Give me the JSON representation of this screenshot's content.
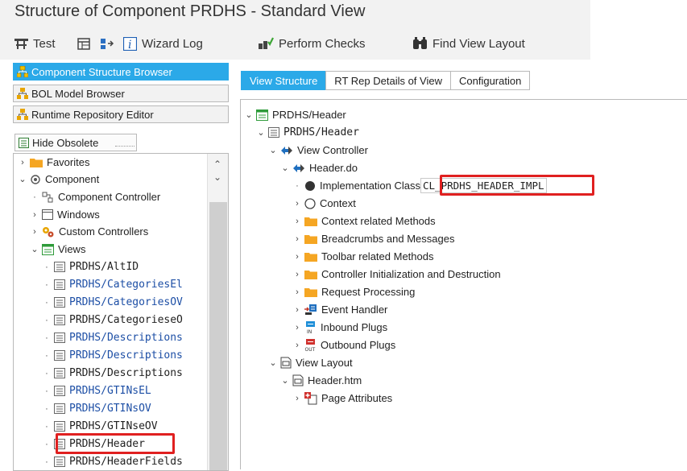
{
  "window": {
    "title": "Structure of Component PRDHS - Standard View"
  },
  "toolbar": {
    "test": "Test",
    "wizard_log": "Wizard Log",
    "perform_checks": "Perform Checks",
    "find_view_layout": "Find View Layout"
  },
  "nav": {
    "component_structure_browser": "Component Structure Browser",
    "bol_model_browser": "BOL Model Browser",
    "runtime_repository_editor": "Runtime Repository Editor",
    "hide_obsolete": "Hide Obsolete"
  },
  "tree": {
    "favorites": "Favorites",
    "component": "Component",
    "component_controller": "Component Controller",
    "windows": "Windows",
    "custom_controllers": "Custom Controllers",
    "views": "Views",
    "view_items": [
      "PRDHS/AltID",
      "PRDHS/CategoriesEl",
      "PRDHS/CategoriesOV",
      "PRDHS/CategorieseO",
      "PRDHS/Descriptions",
      "PRDHS/Descriptions",
      "PRDHS/Descriptions",
      "PRDHS/GTINsEL",
      "PRDHS/GTINsOV",
      "PRDHS/GTINseOV",
      "PRDHS/Header",
      "PRDHS/HeaderFields"
    ]
  },
  "tabs": [
    "View Structure",
    "RT Rep Details of View",
    "Configuration"
  ],
  "view_structure": {
    "root": "PRDHS/Header",
    "view": "PRDHS/Header",
    "view_controller": "View Controller",
    "controller_class": "Header.do",
    "implementation_class_label": "Implementation Class",
    "implementation_class_value": "CL_PRDHS_HEADER_IMPL",
    "context": "Context",
    "context_methods": "Context related Methods",
    "breadcrumbs": "Breadcrumbs and Messages",
    "toolbar_methods": "Toolbar related Methods",
    "controller_init": "Controller Initialization and Destruction",
    "request_processing": "Request Processing",
    "event_handler": "Event Handler",
    "inbound_plugs": "Inbound Plugs",
    "outbound_plugs": "Outbound Plugs",
    "view_layout": "View Layout",
    "layout_file": "Header.htm",
    "page_attributes": "Page Attributes"
  },
  "colors": {
    "accent": "#2ba9e8",
    "highlight": "#e02020",
    "folder": "#f5a623",
    "link": "#1c4ea5"
  }
}
